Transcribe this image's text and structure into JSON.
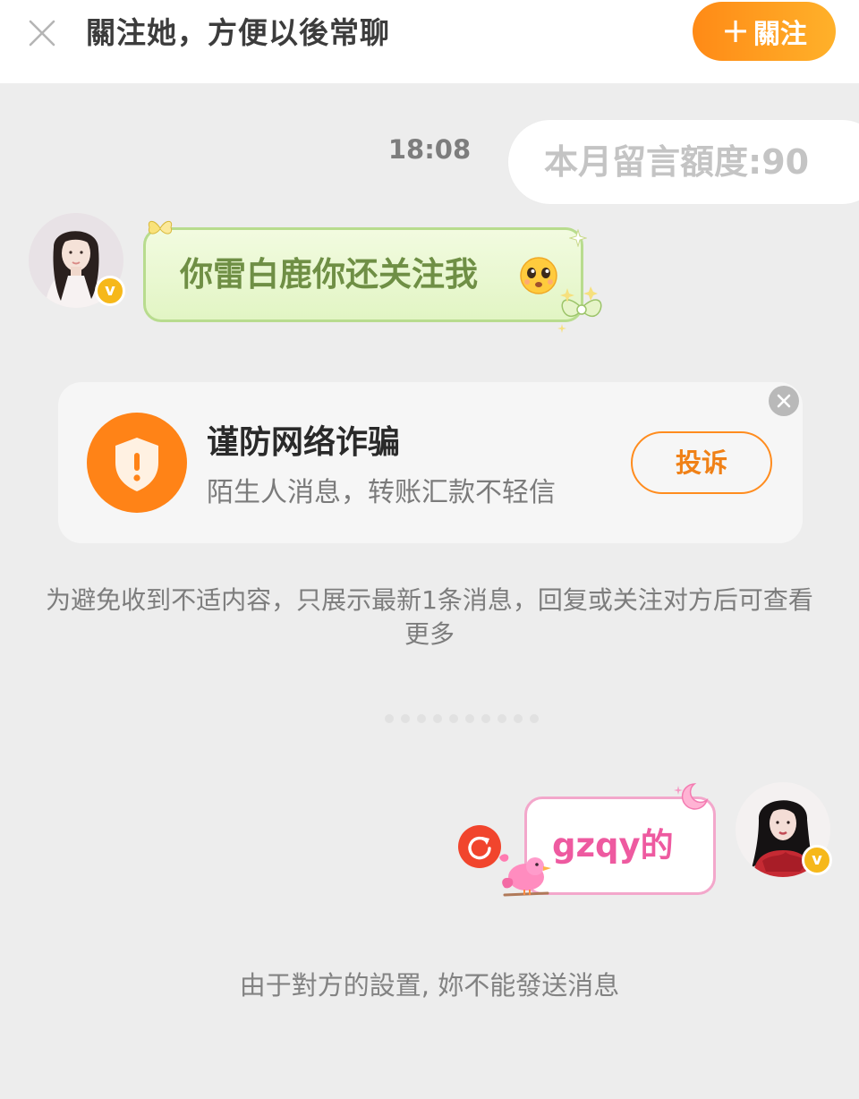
{
  "header": {
    "title": "關注她，方便以後常聊",
    "follow_label": "關注"
  },
  "chat": {
    "timestamp": "18:08",
    "quota": "本月留言額度:90",
    "received_message": "你雷白鹿你还关注我",
    "sent_message": "gzqy的"
  },
  "fraud_card": {
    "title": "谨防网络诈骗",
    "subtitle": "陌生人消息，转账汇款不轻信",
    "report_label": "投诉"
  },
  "notice": "为避免收到不适内容，只展示最新1条消息，回复或关注对方后可查看更多",
  "footer_notice": "由于對方的設置, 妳不能發送消息",
  "colors": {
    "accent": "#ff8a16",
    "received_bubble": "#e6f6cb",
    "sent_border": "#f3a7cb",
    "retry": "#f1452d"
  }
}
